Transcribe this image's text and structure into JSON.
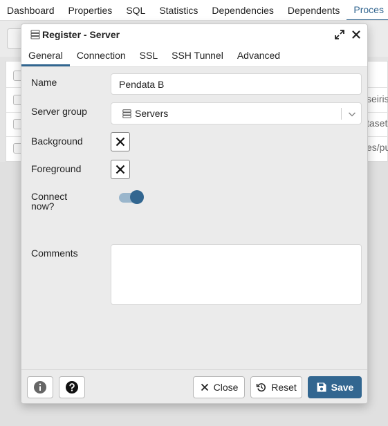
{
  "app": {
    "nav_tabs": [
      "Dashboard",
      "Properties",
      "SQL",
      "Statistics",
      "Dependencies",
      "Dependents",
      "Proces"
    ],
    "active_tab_index": 6,
    "table_cells": [
      "seiris",
      "taset",
      "es/pu"
    ]
  },
  "dialog": {
    "title": "Register - Server",
    "tabs": [
      "General",
      "Connection",
      "SSL",
      "SSH Tunnel",
      "Advanced"
    ],
    "active_tab": "General",
    "fields": {
      "name_label": "Name",
      "name_value": "Pendata B",
      "server_group_label": "Server group",
      "server_group_value": "Servers",
      "background_label": "Background",
      "foreground_label": "Foreground",
      "connect_now_label_line1": "Connect",
      "connect_now_label_line2": "now?",
      "connect_now_on": true,
      "comments_label": "Comments",
      "comments_value": ""
    },
    "footer": {
      "close_label": "Close",
      "reset_label": "Reset",
      "save_label": "Save"
    }
  },
  "colors": {
    "accent": "#326690",
    "toggle_track": "#9ab6cc",
    "body_bg": "#ebebeb"
  },
  "icons": {
    "dialog": "server-icon",
    "expand": "expand-icon",
    "close": "close-icon",
    "select_option": "server-group-icon",
    "select_dropdown": "chevron-down-icon",
    "background_color": "x-icon",
    "foreground_color": "x-icon",
    "info": "info-icon",
    "help": "help-icon",
    "close_button": "close-icon",
    "reset_button": "reset-icon",
    "save_button": "save-icon"
  }
}
